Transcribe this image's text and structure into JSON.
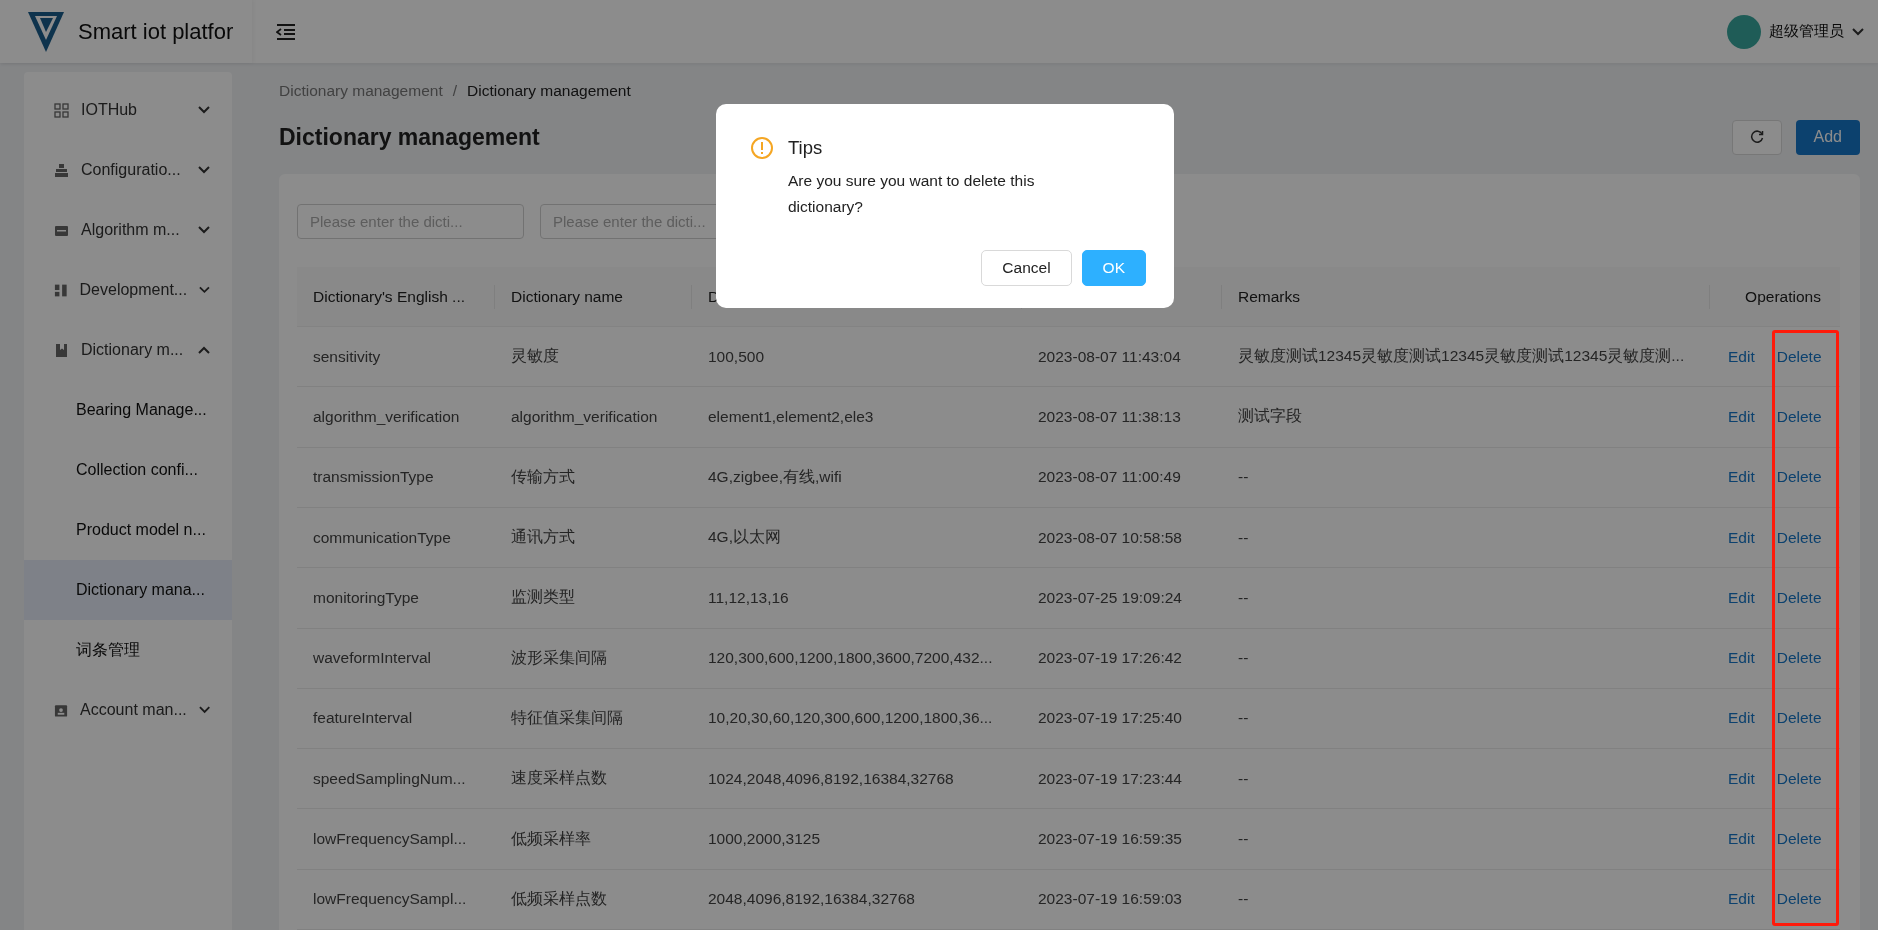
{
  "header": {
    "app_title": "Smart iot platfor",
    "user_name": "超级管理员"
  },
  "sidebar": {
    "items": [
      {
        "label": "IOTHub",
        "kind": "grid",
        "expanded": false
      },
      {
        "label": "Configuratio...",
        "kind": "stack",
        "expanded": false
      },
      {
        "label": "Algorithm m...",
        "kind": "card",
        "expanded": false
      },
      {
        "label": "Development...",
        "kind": "blocks",
        "expanded": false
      },
      {
        "label": "Dictionary m...",
        "kind": "book",
        "expanded": true,
        "children": [
          {
            "label": "Bearing Manage...",
            "selected": false
          },
          {
            "label": "Collection confi...",
            "selected": false
          },
          {
            "label": "Product model n...",
            "selected": false
          },
          {
            "label": "Dictionary mana...",
            "selected": true
          },
          {
            "label": "词条管理",
            "selected": false
          }
        ]
      },
      {
        "label": "Account man...",
        "kind": "contact",
        "expanded": false
      }
    ]
  },
  "breadcrumb": {
    "separator": "/",
    "items": [
      "Dictionary management",
      "Dictionary management"
    ]
  },
  "page_title": "Dictionary management",
  "actions": {
    "add": "Add"
  },
  "filters": [
    {
      "placeholder": "Please enter the dicti..."
    },
    {
      "placeholder": "Please enter the dicti..."
    }
  ],
  "table": {
    "columns": [
      {
        "label": "Dictionary's English ..."
      },
      {
        "label": "Dictionary name"
      },
      {
        "label": "D"
      },
      {},
      {
        "label": "Remarks"
      },
      {
        "label": "Operations"
      }
    ],
    "rows": [
      {
        "english_name": "sensitivity",
        "name": "灵敏度",
        "values": "100,500",
        "time": "2023-08-07 11:43:04",
        "remarks": "灵敏度测试12345灵敏度测试12345灵敏度测试12345灵敏度测...",
        "edit": "Edit",
        "delete": "Delete"
      },
      {
        "english_name": "algorithm_verification",
        "name": "algorithm_verification",
        "values": "element1,element2,ele3",
        "time": "2023-08-07 11:38:13",
        "remarks": "测试字段",
        "edit": "Edit",
        "delete": "Delete"
      },
      {
        "english_name": "transmissionType",
        "name": "传输方式",
        "values": "4G,zigbee,有线,wifi",
        "time": "2023-08-07 11:00:49",
        "remarks": "--",
        "edit": "Edit",
        "delete": "Delete"
      },
      {
        "english_name": "communicationType",
        "name": "通讯方式",
        "values": "4G,以太网",
        "time": "2023-08-07 10:58:58",
        "remarks": "--",
        "edit": "Edit",
        "delete": "Delete"
      },
      {
        "english_name": "monitoringType",
        "name": "监测类型",
        "values": "11,12,13,16",
        "time": "2023-07-25 19:09:24",
        "remarks": "--",
        "edit": "Edit",
        "delete": "Delete"
      },
      {
        "english_name": "waveformInterval",
        "name": "波形采集间隔",
        "values": "120,300,600,1200,1800,3600,7200,432...",
        "time": "2023-07-19 17:26:42",
        "remarks": "--",
        "edit": "Edit",
        "delete": "Delete"
      },
      {
        "english_name": "featureInterval",
        "name": "特征值采集间隔",
        "values": "10,20,30,60,120,300,600,1200,1800,36...",
        "time": "2023-07-19 17:25:40",
        "remarks": "--",
        "edit": "Edit",
        "delete": "Delete"
      },
      {
        "english_name": "speedSamplingNum...",
        "name": "速度采样点数",
        "values": "1024,2048,4096,8192,16384,32768",
        "time": "2023-07-19 17:23:44",
        "remarks": "--",
        "edit": "Edit",
        "delete": "Delete"
      },
      {
        "english_name": "lowFrequencySampl...",
        "name": "低频采样率",
        "values": "1000,2000,3125",
        "time": "2023-07-19 16:59:35",
        "remarks": "--",
        "edit": "Edit",
        "delete": "Delete"
      },
      {
        "english_name": "lowFrequencySampl...",
        "name": "低频采样点数",
        "values": "2048,4096,8192,16384,32768",
        "time": "2023-07-19 16:59:03",
        "remarks": "--",
        "edit": "Edit",
        "delete": "Delete"
      }
    ]
  },
  "dialog": {
    "title": "Tips",
    "message": "Are you sure you want to delete this dictionary?",
    "buttons": [
      {
        "label": "Cancel",
        "kind": "default"
      },
      {
        "label": "OK",
        "kind": "primary"
      }
    ]
  }
}
